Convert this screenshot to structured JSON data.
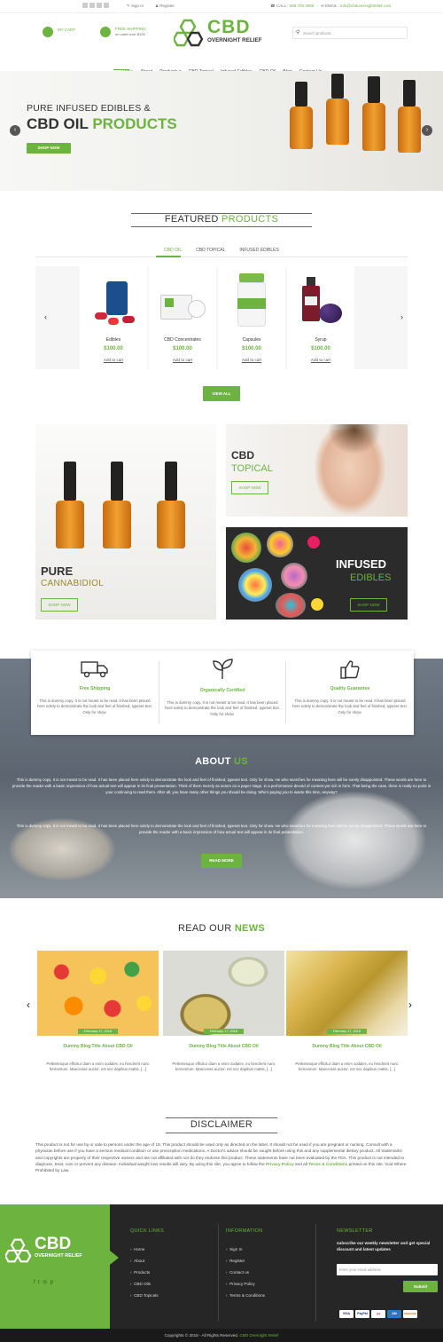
{
  "topbar": {
    "signin": "Sign In",
    "register": "Register",
    "call_label": "CALL :",
    "phone": "559.700.4990",
    "email_label": "EMAIL :",
    "email": "info@cbdovernightrelief.com"
  },
  "header": {
    "cart": "MY CART",
    "shipping_title": "FREE SHIPPING",
    "shipping_sub": "on order over $100",
    "logo_main": "CBD",
    "logo_sub": "OVERNIGHT RELIEF",
    "search_placeholder": "Search products..."
  },
  "nav": [
    "Home",
    "About",
    "Products",
    "CBD Topical",
    "Infused Edibles",
    "CBD Oil",
    "Blog",
    "Contact Us"
  ],
  "hero": {
    "line1": "PURE INFUSED EDIBLES &",
    "line2a": "CBD OIL ",
    "line2b": "PRODUCTS",
    "cta": "SHOP NOW"
  },
  "featured": {
    "title_a": "FEATURED ",
    "title_b": "PRODUCTS",
    "tabs": [
      "CBD OIL",
      "CBD TOPICAL",
      "INFUSED EDIBLES"
    ],
    "products": [
      {
        "name": "Edibles",
        "price": "$100.00",
        "cart": "Add to cart"
      },
      {
        "name": "CBD Concentrates",
        "price": "$100.00",
        "cart": "Add to cart"
      },
      {
        "name": "Capsules",
        "price": "$100.00",
        "cart": "Add to cart"
      },
      {
        "name": "Syrup",
        "price": "$100.00",
        "cart": "Add to cart"
      }
    ],
    "view_all": "VIEW ALL"
  },
  "banners": {
    "pure_a": "PURE",
    "pure_b": "CANNABIDIOL",
    "topical_a": "CBD",
    "topical_b": "TOPICAL",
    "edibles_a": "INFUSED",
    "edibles_b": "EDIBLES",
    "shop": "SHOP NOW"
  },
  "features": [
    {
      "title": "Free Shipping",
      "text": "This is dummy copy. It is not meant to be read. It has been placed here solely to demonstrate the look and feel of finished, typeset text. Only for show.",
      "icon": "truck-icon"
    },
    {
      "title": "Organically Certified",
      "text": "This is dummy copy. It is not meant to be read. It has been placed here solely to demonstrate the look and feel of finished, typeset text. Only for show.",
      "icon": "leaf-icon"
    },
    {
      "title": "Quality Guarantee",
      "text": "This is dummy copy. It is not meant to be read. It has been placed here solely to demonstrate the look and feel of finished, typeset text. Only for show.",
      "icon": "thumbs-up-icon"
    }
  ],
  "about": {
    "title_a": "ABOUT ",
    "title_b": "US",
    "p1": "This is dummy copy. It is not meant to be read. It has been placed here solely to demonstrate the look and feel of finished, typeset text. Only for show. He who searches for meaning here will be sorely disappointed. These words are here to provide the reader with a basic impression of how actual text will appear in its final presentation. Think of them merely as actors on a paper stage, in a performance devoid of content yet rich in form. That being the case, there is really no point in your continuing to read them. After all, you have many other things you should be doing. Who's paying you to waste this time, anyway?",
    "p2": "This is dummy copy. It is not meant to be read. It has been placed here solely to demonstrate the look and feel of finished, typeset text. Only for show. He who searches for meaning here will be sorely disappointed. These words are here to provide the reader with a basic impression of how actual text will appear in its final presentation.",
    "cta": "READ MORE"
  },
  "news": {
    "title_a": "READ OUR ",
    "title_b": "NEWS",
    "items": [
      {
        "date": "February 17, 2018",
        "title": "Dummy Blog Title About CBD Oil",
        "text": "Pellentesque efficitur diam a enim sodales, eu hendrerit nunc fermentum. Maecenas auctor, est nec dapibus mattis, [...]"
      },
      {
        "date": "February 17, 2018",
        "title": "Dummy Blog Title About CBD Oil",
        "text": "Pellentesque efficitur diam a enim sodales, eu hendrerit nunc fermentum. Maecenas auctor, est nec dapibus mattis, [...]"
      },
      {
        "date": "February 17, 2018",
        "title": "Dummy Blog Title About CBD Oil",
        "text": "Pellentesque efficitur diam a enim sodales, eu hendrerit nunc fermentum. Maecenas auctor, est nec dapibus mattis, [...]"
      }
    ]
  },
  "disclaimer": {
    "title": "DISCLAIMER",
    "text_a": "This product is not for use by or sale to persons under the age of 18. This product should be used only as directed on the label. It should not be used if you are pregnant or nursing. Consult with a physician before use if you have a serious medical condition or use prescription medications. A Doctor's advice should be sought before using this and any supplemental dietary product. All trademarks and copyrights are property of their respective owners and are not affiliated with nor do they endorse this product. These statements have not been evaluated by the FDA. This product is not intended to diagnose, treat, cure or prevent any disease. Individual weight loss results will vary. By using this site, you agree to follow the ",
    "privacy": "Privacy Policy",
    "and": " and all ",
    "terms": "Terms & Conditions",
    "text_b": " printed on this site. Void Where Prohibited by Law."
  },
  "footer": {
    "quick_title": "QUICK LINKS",
    "quick": [
      "Home",
      "About",
      "Products",
      "CBD Oils",
      "CBD Topicals"
    ],
    "info_title": "INFORMATION",
    "info": [
      "Sign In",
      "Register",
      "Contact us",
      "Privacy Policy",
      "Terms & Conditions"
    ],
    "news_title": "NEWSLETTER",
    "news_text": "subscribe our weekly newsletter and get special discount and latest updates",
    "email_placeholder": "Enter your email address",
    "submit": "Submit",
    "payments": [
      "VISA",
      "PayPal",
      "",
      "",
      "DISCOVER"
    ],
    "copyright": "Copyrights © 2018 - All Rights Reserved. ",
    "copyright_brand": "CBD Overnight Relief"
  },
  "colors": {
    "accent": "#6db33f",
    "dark": "#262626"
  }
}
